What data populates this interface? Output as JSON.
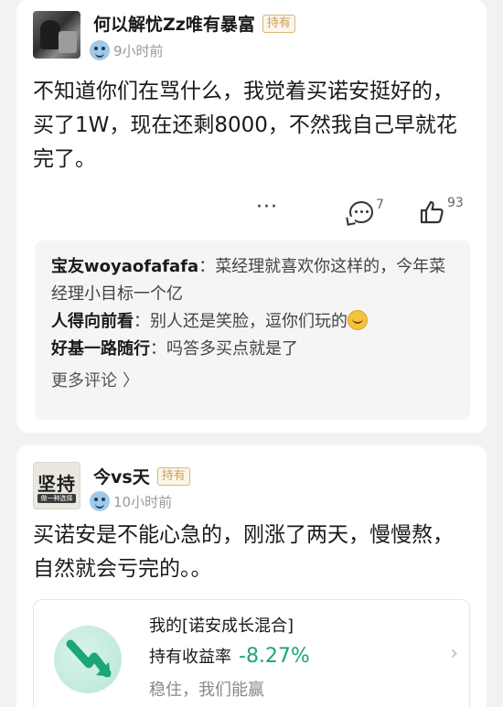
{
  "posts": [
    {
      "author": "何以解忧Zz唯有暴富",
      "badge": "持有",
      "time": "9小时前",
      "content": "不知道你们在骂什么，我觉着买诺安挺好的，买了1W，现在还剩8000，不然我自己早就花完了。",
      "actions": {
        "more": "···",
        "comments": "7",
        "likes": "93"
      },
      "comments": [
        {
          "user": "宝友woyaofafafa",
          "sep": "：",
          "text": "菜经理就喜欢你这样的，今年菜经理小目标一个亿"
        },
        {
          "user": "人得向前看",
          "sep": "：",
          "text": "别人还是笑脸，逗你们玩的",
          "emoji": "laughing-tears-emoji"
        },
        {
          "user": "好基一路随行",
          "sep": "：",
          "text": "吗答多买点就是了"
        }
      ],
      "more_comments": "更多评论",
      "more_comments_chevron": "〉"
    },
    {
      "author": "今vs天",
      "badge": "持有",
      "time": "10小时前",
      "avatar_text": "坚持",
      "avatar_subtext": "做一种选择",
      "content": "买诺安是不能心急的，刚涨了两天，慢慢熬，自然就会亏完的。。",
      "product": {
        "title": "我的[诺安成长混合]",
        "metric_label": "持有收益率",
        "metric_value": "-8.27%",
        "tagline": "稳住，我们能赢",
        "chevron": "›"
      }
    }
  ],
  "colors": {
    "background": "#f2f2f2",
    "badge": "#c9a15a",
    "metric_value": "#1aa67a",
    "timestamp": "#999999"
  }
}
